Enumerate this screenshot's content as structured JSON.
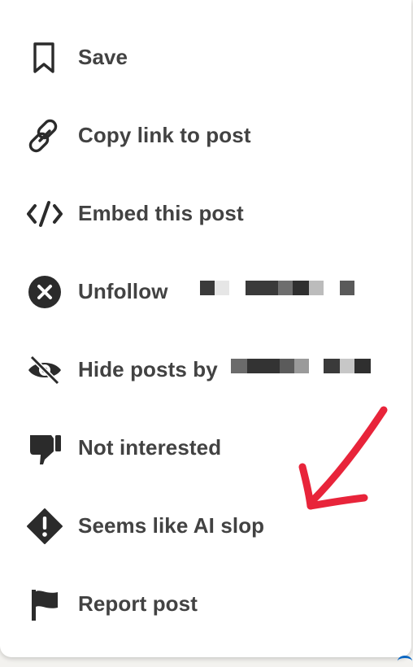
{
  "menu": {
    "items": [
      {
        "label": "Save",
        "icon": "bookmark-icon"
      },
      {
        "label": "Copy link to post",
        "icon": "link-icon"
      },
      {
        "label": "Embed this post",
        "icon": "code-icon"
      },
      {
        "label": "Unfollow",
        "icon": "close-circle-icon"
      },
      {
        "label": "Hide posts by",
        "icon": "eye-slash-icon"
      },
      {
        "label": "Not interested",
        "icon": "thumbs-down-icon"
      },
      {
        "label": "Seems like AI slop",
        "icon": "alert-diamond-icon"
      },
      {
        "label": "Report post",
        "icon": "flag-icon"
      }
    ]
  },
  "colors": {
    "text": "#424242",
    "icon": "#2b2b2b",
    "annotation_arrow": "#e8243a",
    "background": "#ffffff"
  }
}
